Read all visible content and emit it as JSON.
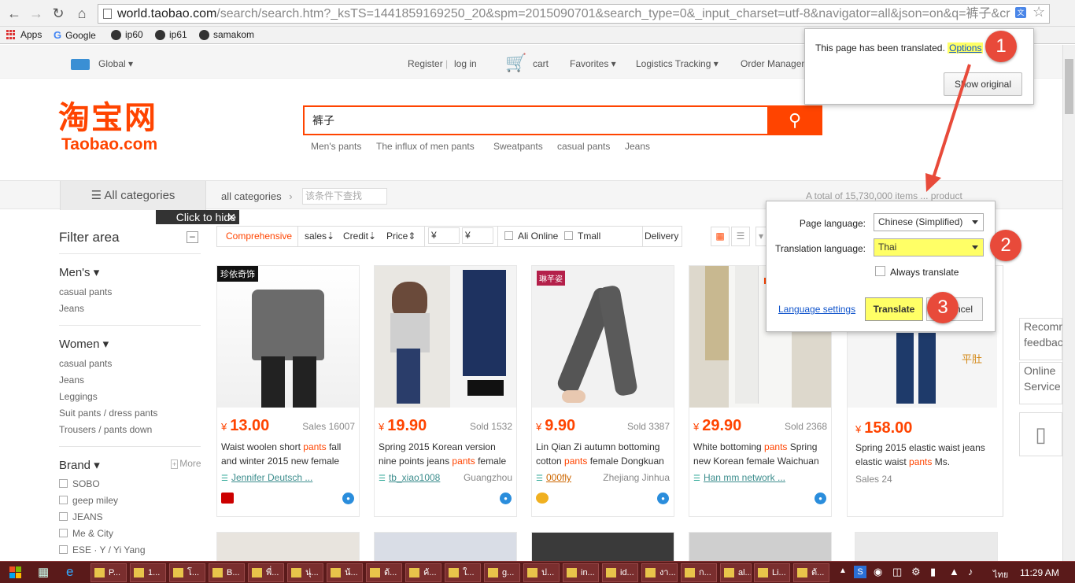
{
  "browser": {
    "url_host": "world.taobao.com",
    "url_rest": "/search/search.htm?_ksTS=1441859169250_20&spm=2015090701&search_type=0&_input_charset=utf-8&navigator=all&json=on&q=裤子&cr",
    "bookmarks": [
      "Apps",
      "Google",
      "ip60",
      "ip61",
      "samakom"
    ]
  },
  "site_top": {
    "global": "Global ▾",
    "register": "Register",
    "login": "log in",
    "cart": "cart",
    "favorites": "Favorites ▾",
    "logistics": "Logistics Tracking ▾",
    "order": "Order Managem"
  },
  "logo": {
    "cn": "淘宝网",
    "en": "Taobao.com"
  },
  "search": {
    "query": "裤子",
    "hotwords": [
      "Men's pants",
      "The influx of men pants",
      "Sweatpants",
      "casual pants",
      "Jeans"
    ]
  },
  "catbar": {
    "all_categories": "All categories",
    "crumb": "all categories",
    "filter_placeholder": "该条件下查找",
    "total_text": "A total of 15,730,000 items ... product"
  },
  "hide_tip": "Click to hide",
  "filter": {
    "title": "Filter area",
    "mens": "Men's ▾",
    "mens_items": [
      "casual pants",
      "Jeans"
    ],
    "women": "Women ▾",
    "women_items": [
      "casual pants",
      "Jeans",
      "Leggings",
      "Suit pants / dress pants",
      "Trousers / pants down"
    ],
    "brand": "Brand ▾",
    "more": "More",
    "brands": [
      "SOBO",
      "geep miley",
      "JEANS",
      "Me & City",
      "ESE · Y / Yi Yang"
    ]
  },
  "sort": {
    "comprehensive": "Comprehensive",
    "sales": "sales⇣",
    "credit": "Credit⇣",
    "price": "Price⇕",
    "yen1": "¥",
    "yen2": "¥",
    "ali": "Ali Online",
    "tmall": "Tmall",
    "delivery": "Delivery"
  },
  "products": [
    {
      "price": "13.00",
      "sales": "Sales 16007",
      "title_a": "Waist woolen short ",
      "hl": "pants",
      "title_b": " fall and winter 2015 new female",
      "shop": "Jennifer Deutsch ...",
      "loc": ""
    },
    {
      "price": "19.90",
      "sales": "Sold 1532",
      "title_a": "Spring 2015 Korean version nine points jeans ",
      "hl": "pants",
      "title_b": " female",
      "shop": "tb_xiao1008",
      "loc": "Guangzhou"
    },
    {
      "price": "9.90",
      "sales": "Sold 3387",
      "title_a": "Lin Qian Zi autumn bottoming cotton ",
      "hl": "pants",
      "title_b": " female Dongkuan",
      "shop": "000fly",
      "loc": "Zhejiang Jinhua"
    },
    {
      "price": "29.90",
      "sales": "Sold 2368",
      "title_a": "White bottoming ",
      "hl": "pants",
      "title_b": " Spring new Korean female Waichuan",
      "shop": "Han mm network ...",
      "loc": ""
    },
    {
      "price": "158.00",
      "sales": "Sales 24",
      "title_a": "Spring 2015 elastic waist jeans elastic waist ",
      "hl": "pants",
      "title_b": " Ms.",
      "shop": "",
      "loc": ""
    }
  ],
  "img_labels": {
    "p1": "珍依奇饰",
    "p3": "琳芊姿",
    "p5": "平肚"
  },
  "rightside": {
    "recomm": "Recomm feedback",
    "online": "Online Service"
  },
  "translate_bubble": {
    "message": "This page has been translated.",
    "options": "Options",
    "show_original": "Show original"
  },
  "translate_panel": {
    "page_language_label": "Page language:",
    "page_language": "Chinese (Simplified)",
    "translation_language_label": "Translation language:",
    "translation_language": "Thai",
    "always": "Always translate",
    "language_settings": "Language settings",
    "translate": "Translate",
    "cancel": "Cancel"
  },
  "callouts": [
    "1",
    "2",
    "3"
  ],
  "taskbar": {
    "items": [
      "P...",
      "1...",
      "โ...",
      "B...",
      "พี่...",
      "นุ่...",
      "น้...",
      "ต้...",
      "ค้...",
      "ใ...",
      "g...",
      "ป...",
      "in...",
      "id...",
      "งา...",
      "ก...",
      "al...",
      "Li...",
      "ต้..."
    ],
    "lang": "ไทย",
    "clock": "11:29 AM"
  },
  "colors": {
    "brand": "#ff4400",
    "highlight": "#ffff66",
    "callout": "#e84a3a",
    "taskbar": "#5a1a1a"
  }
}
